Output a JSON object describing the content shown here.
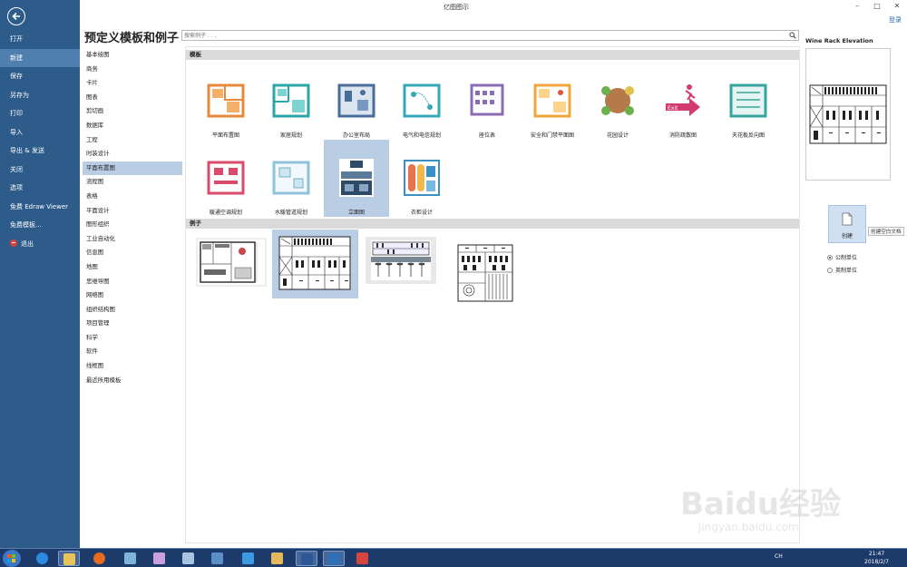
{
  "window": {
    "title": "亿图图示",
    "login_label": "登录",
    "min": "–",
    "max": "□",
    "close": "✕"
  },
  "backstage": {
    "items": [
      {
        "label": "打开",
        "active": false
      },
      {
        "label": "新建",
        "active": true
      },
      {
        "label": "保存",
        "active": false
      },
      {
        "label": "另存为",
        "active": false
      },
      {
        "label": "打印",
        "active": false
      },
      {
        "label": "导入",
        "active": false
      },
      {
        "label": "导出 & 发送",
        "active": false
      },
      {
        "label": "关闭",
        "active": false
      },
      {
        "label": "选项",
        "active": false
      },
      {
        "label": "免费 Edraw Viewer",
        "active": false
      },
      {
        "label": "免费模板...",
        "active": false
      },
      {
        "label": "退出",
        "active": false,
        "icon": "exit-icon"
      }
    ]
  },
  "heading": "预定义模板和例子",
  "search": {
    "placeholder": "搜索例子 . . ."
  },
  "categories": [
    "基本绘图",
    "商务",
    "卡片",
    "图表",
    "剪切画",
    "数据库",
    "工程",
    "时装设计",
    "平面布置图",
    "流程图",
    "表格",
    "平面设计",
    "图形组织",
    "工业自动化",
    "信息图",
    "地图",
    "思维导图",
    "网络图",
    "组织结构图",
    "项目管理",
    "科学",
    "软件",
    "线框图",
    "最近所用模板"
  ],
  "active_category": "平面布置图",
  "templates_header": "模板",
  "examples_header": "例子",
  "templates": [
    {
      "label": "平面布置图",
      "icon": "floor-plan-icon"
    },
    {
      "label": "家居规划",
      "icon": "home-plan-icon"
    },
    {
      "label": "办公室布局",
      "icon": "office-layout-icon"
    },
    {
      "label": "电气和电信规划",
      "icon": "electrical-plan-icon"
    },
    {
      "label": "座位表",
      "icon": "seating-chart-icon"
    },
    {
      "label": "安全和门禁平面图",
      "icon": "security-plan-icon"
    },
    {
      "label": "花园设计",
      "icon": "garden-design-icon"
    },
    {
      "label": "消防疏散图",
      "icon": "fire-exit-icon"
    },
    {
      "label": "天花板反向图",
      "icon": "ceiling-plan-icon"
    },
    {
      "label": "暖通空调规划",
      "icon": "hvac-plan-icon"
    },
    {
      "label": "水暖管道规划",
      "icon": "plumbing-plan-icon"
    },
    {
      "label": "立面图",
      "icon": "elevation-icon",
      "selected": true
    },
    {
      "label": "衣柜设计",
      "icon": "wardrobe-design-icon"
    }
  ],
  "examples": [
    {
      "name": "kitchen-plan-example"
    },
    {
      "name": "wine-rack-elevation-example",
      "selected": true
    },
    {
      "name": "bar-elevation-example"
    },
    {
      "name": "cabinet-elevation-example"
    }
  ],
  "preview": {
    "title": "Wine Rack Elevation"
  },
  "create": {
    "label": "创建",
    "tooltip": "创建空白文档"
  },
  "units": [
    {
      "label": "公制单位",
      "checked": true
    },
    {
      "label": "英制单位",
      "checked": false
    }
  ],
  "watermark": {
    "text": "Baidu经验",
    "url": "jingyan.baidu.com"
  },
  "taskbar": {
    "lang": "CH",
    "time": "21:47",
    "date": "2018/2/7"
  }
}
